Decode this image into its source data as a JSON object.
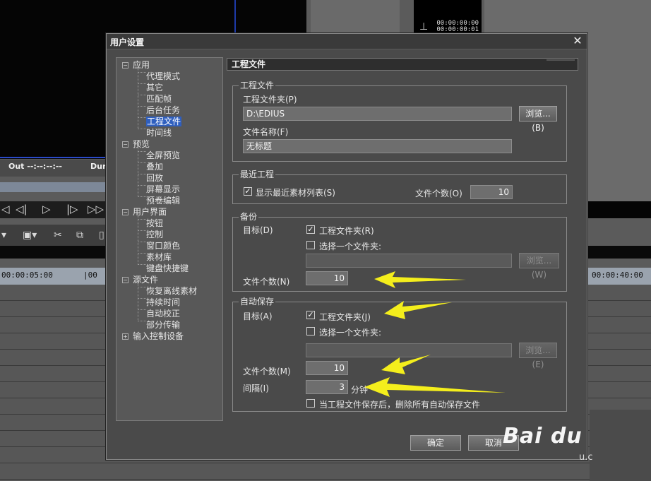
{
  "background": {
    "out_label": "Out --:--:--:--",
    "dur_label": "Dur",
    "mini_timecodes": [
      "00:00:00:00",
      "00:00:00:01"
    ],
    "ruler_timecodes": [
      "00:00:05:00",
      "|00",
      "00:00:40:00"
    ],
    "transport_icons": [
      "prev-icon",
      "step-back-icon",
      "play-icon",
      "step-forward-icon",
      "fast-forward-icon"
    ],
    "toolbar_icons": [
      "save-icon",
      "cut-icon",
      "copy-icon"
    ]
  },
  "dialog": {
    "title": "用户设置",
    "close_glyph": "✕",
    "ok_label": "确定",
    "cancel_label": "取消"
  },
  "tree": {
    "selected": "工程文件",
    "groups": [
      {
        "label": "应用",
        "expanded": true,
        "children": [
          "代理模式",
          "其它",
          "匹配帧",
          "后台任务",
          "工程文件",
          "时间线"
        ]
      },
      {
        "label": "预览",
        "expanded": true,
        "children": [
          "全屏预览",
          "叠加",
          "回放",
          "屏幕显示",
          "预卷编辑"
        ]
      },
      {
        "label": "用户界面",
        "expanded": true,
        "children": [
          "按钮",
          "控制",
          "窗口颜色",
          "素材库",
          "键盘快捷键"
        ]
      },
      {
        "label": "源文件",
        "expanded": true,
        "children": [
          "恢复离线素材",
          "持续时间",
          "自动校正",
          "部分传输"
        ]
      },
      {
        "label": "输入控制设备",
        "expanded": false,
        "children": []
      }
    ]
  },
  "panel": {
    "title": "工程文件",
    "project_file": {
      "legend": "工程文件",
      "folder_label": "工程文件夹(P)",
      "folder_value": "D:\\EDIUS",
      "browse_label": "浏览...(B)",
      "name_label": "文件名称(F)",
      "name_value": "无标题"
    },
    "recent": {
      "legend": "最近工程",
      "show_list_label": "显示最近素材列表(S)",
      "show_list_checked": true,
      "count_label": "文件个数(O)",
      "count_value": "10"
    },
    "backup": {
      "legend": "备份",
      "target_label": "目标(D)",
      "option_project_folder": "工程文件夹(R)",
      "option_project_folder_checked": true,
      "option_choose_folder": "选择一个文件夹:",
      "option_choose_folder_checked": false,
      "folder_value": "",
      "browse_label": "浏览...(W)",
      "count_label": "文件个数(N)",
      "count_value": "10"
    },
    "autosave": {
      "legend": "自动保存",
      "target_label": "目标(A)",
      "option_project_folder": "工程文件夹(J)",
      "option_project_folder_checked": true,
      "option_choose_folder": "选择一个文件夹:",
      "option_choose_folder_checked": false,
      "folder_value": "",
      "browse_label": "浏览...(E)",
      "count_label": "文件个数(M)",
      "count_value": "10",
      "interval_label": "间隔(I)",
      "interval_value": "3",
      "interval_unit": "分钟",
      "delete_label": "当工程文件保存后，删除所有自动保存文件",
      "delete_checked": false
    }
  },
  "watermark": {
    "text": "Bai du",
    "sub": "u.c"
  },
  "colors": {
    "arrow": "#f4ee1c",
    "selection": "#2f5fbf"
  }
}
